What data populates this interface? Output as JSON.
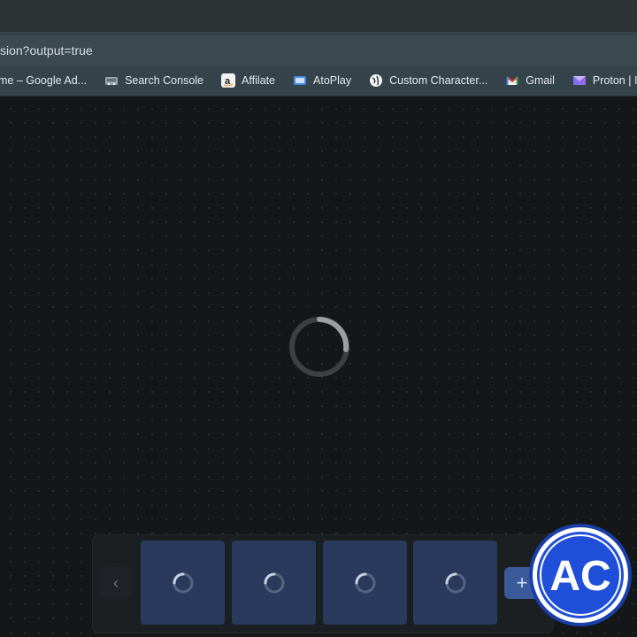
{
  "browser": {
    "address": "sion?output=true",
    "bookmarks": [
      {
        "label": "me – Google Ad...",
        "icon": "google-ads-icon"
      },
      {
        "label": "Search Console",
        "icon": "search-console-icon"
      },
      {
        "label": "Affilate",
        "icon": "amazon-icon"
      },
      {
        "label": "AtoPlay",
        "icon": "atoplay-icon"
      },
      {
        "label": "Custom Character...",
        "icon": "globe-icon"
      },
      {
        "label": "Gmail",
        "icon": "gmail-icon"
      },
      {
        "label": "Proton | Inbox",
        "icon": "proton-icon"
      }
    ]
  },
  "content": {
    "state": "loading",
    "thumbnails": [
      {
        "state": "loading"
      },
      {
        "state": "loading"
      },
      {
        "state": "loading"
      },
      {
        "state": "loading"
      }
    ],
    "prev_label": "‹",
    "add_label": "+"
  },
  "badge": {
    "text": "AC",
    "colors": {
      "fill": "#1f4fd8",
      "ring": "#ffffff"
    }
  }
}
